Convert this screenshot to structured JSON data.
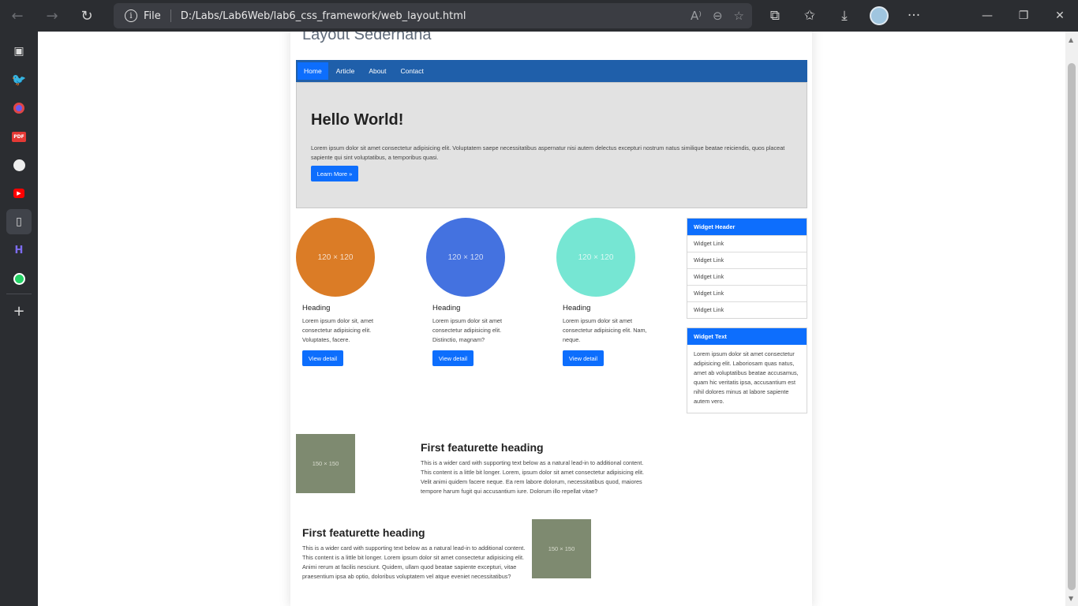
{
  "browser": {
    "address_prefix": "File",
    "url": "D:/Labs/Lab6Web/lab6_css_framework/web_layout.html"
  },
  "site": {
    "title": "Layout Sederhana",
    "nav": [
      "Home",
      "Article",
      "About",
      "Contact"
    ],
    "hero": {
      "heading": "Hello World!",
      "text": "Lorem ipsum dolor sit amet consectetur adipisicing elit. Voluptatem saepe necessitatibus aspernatur nisi autem delectus excepturi nostrum natus similique beatae reiciendis, quos placeat sapiente qui sint voluptatibus, a temporibus quasi.",
      "button": "Learn More »"
    },
    "cards": [
      {
        "placeholder": "120 × 120",
        "color": "#db7c26",
        "heading": "Heading",
        "text": "Lorem ipsum dolor sit, amet consectetur adipisicing elit. Voluptates, facere.",
        "button": "View detail"
      },
      {
        "placeholder": "120 × 120",
        "color": "#4472e0",
        "heading": "Heading",
        "text": "Lorem ipsum dolor sit amet consectetur adipisicing elit. Distinctio, magnam?",
        "button": "View detail"
      },
      {
        "placeholder": "120 × 120",
        "color": "#76e6d3",
        "heading": "Heading",
        "text": "Lorem ipsum dolor sit amet consectetur adipisicing elit. Nam, neque.",
        "button": "View detail"
      }
    ],
    "widget_links": {
      "header": "Widget Header",
      "links": [
        "Widget Link",
        "Widget Link",
        "Widget Link",
        "Widget Link",
        "Widget Link"
      ]
    },
    "widget_text": {
      "header": "Widget Text",
      "text": "Lorem ipsum dolor sit amet consectetur adipisicing elit. Laboriosam quas natus, amet ab voluptatibus beatae accusamus, quam hic veritatis ipsa, accusantium est nihil dolores minus at labore sapiente autem vero."
    },
    "featurettes": [
      {
        "placeholder": "150 × 150",
        "heading": "First featurette heading",
        "text": "This is a wider card with supporting text below as a natural lead-in to additional content. This content is a little bit longer. Lorem, ipsum dolor sit amet consectetur adipisicing elit. Velit animi quidem facere neque. Ea rem labore dolorum, necessitatibus quod, maiores tempore harum fugit qui accusantium iure. Dolorum illo repellat vitae?"
      },
      {
        "placeholder": "150 × 150",
        "heading": "First featurette heading",
        "text": "This is a wider card with supporting text below as a natural lead-in to additional content. This content is a little bit longer. Lorem ipsum dolor sit amet consectetur adipisicing elit. Animi rerum at facilis nesciunt. Quidem, ullam quod beatae sapiente excepturi, vitae praesentium ipsa ab optio, doloribus voluptatem vel atque eveniet necessitatibus?"
      }
    ],
    "placeholder_color": "#7e8a70",
    "accent": "#0d6efd",
    "navbar_color": "#1f5faa"
  },
  "sidebar_icons": [
    "sidebar-toggle-icon",
    "twitter-icon",
    "chrome-icon",
    "pdf-icon",
    "github-icon",
    "youtube-icon",
    "document-icon",
    "hasura-icon",
    "whatsapp-icon",
    "add-icon"
  ]
}
